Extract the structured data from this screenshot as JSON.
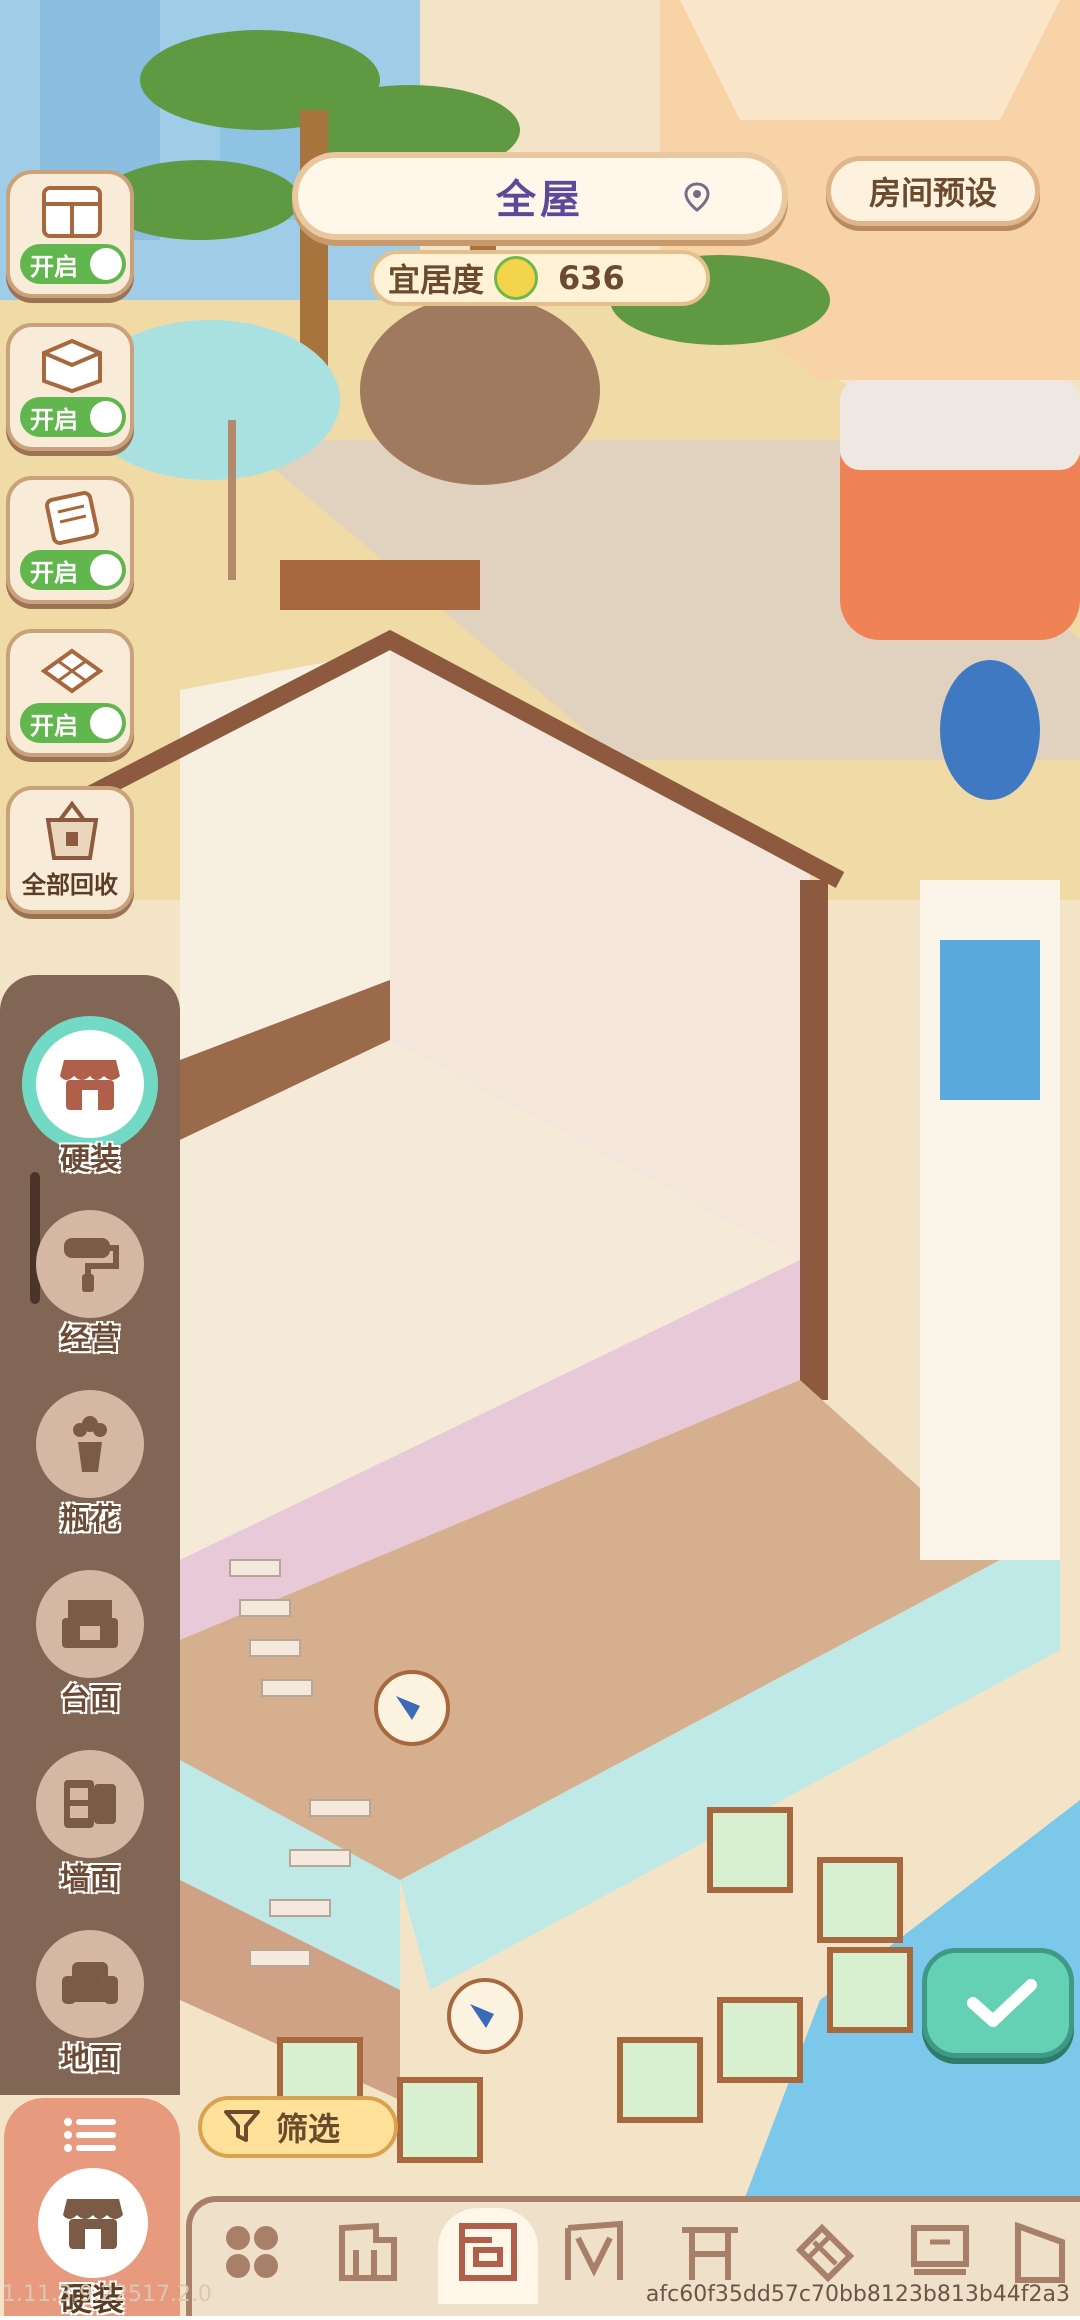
{
  "header": {
    "title": "全屋",
    "preset_button": "房间预设",
    "comfort_label": "宜居度",
    "comfort_value": "636"
  },
  "toggles": [
    {
      "icon": "cabinet-icon",
      "label": "开启"
    },
    {
      "icon": "wall-cube-icon",
      "label": "开启"
    },
    {
      "icon": "wallpaper-icon",
      "label": "开启"
    },
    {
      "icon": "floor-tile-icon",
      "label": "开启"
    }
  ],
  "recycle_all": "全部回收",
  "categories": [
    {
      "label": "硬装",
      "icon": "storefront-icon",
      "active": true
    },
    {
      "label": "经营",
      "icon": "paint-roller-icon"
    },
    {
      "label": "瓶花",
      "icon": "flower-vase-icon"
    },
    {
      "label": "台面",
      "icon": "counter-icon"
    },
    {
      "label": "墙面",
      "icon": "wall-shelf-icon"
    },
    {
      "label": "地面",
      "icon": "sofa-icon"
    }
  ],
  "menu_button": {
    "label": "硬装"
  },
  "filter_label": "筛选",
  "bottom_tabs": [
    "grid-icon",
    "wall-panel-icon",
    "wallpaper-tab-icon",
    "door-frame-icon",
    "fence-icon",
    "stairs-icon",
    "window-icon",
    "slope-icon"
  ],
  "version": "1.11.3.9.22517.2.0",
  "build_hash": "afc60f35dd57c70bb8123b813b44f2a3",
  "colors": {
    "accent": "#64d0b4",
    "panel": "#6e5042",
    "toggle_on": "#61b64e"
  }
}
